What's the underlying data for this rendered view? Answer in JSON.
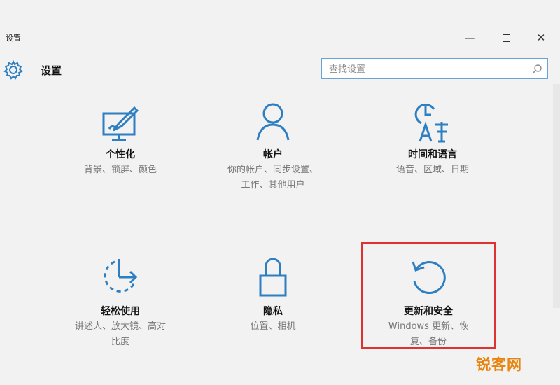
{
  "window": {
    "title": "设置",
    "controls": {
      "minimize": "—",
      "close": "✕"
    }
  },
  "header": {
    "title": "设置",
    "icon": "gear-icon",
    "accent_color": "#2e7fc1"
  },
  "search": {
    "placeholder": "查找设置",
    "icon": "search-icon"
  },
  "tiles": [
    {
      "label": "个性化",
      "desc_line1": "背景、锁屏、颜色",
      "desc_line2": "",
      "icon": "personalization-icon"
    },
    {
      "label": "帐户",
      "desc_line1": "你的帐户、同步设置、",
      "desc_line2": "工作、其他用户",
      "icon": "account-icon"
    },
    {
      "label": "时间和语言",
      "desc_line1": "语音、区域、日期",
      "desc_line2": "",
      "icon": "time-language-icon"
    },
    {
      "label": "轻松使用",
      "desc_line1": "讲述人、放大镜、高对",
      "desc_line2": "比度",
      "icon": "ease-of-access-icon"
    },
    {
      "label": "隐私",
      "desc_line1": "位置、相机",
      "desc_line2": "",
      "icon": "privacy-lock-icon"
    },
    {
      "label": "更新和安全",
      "desc_line1": "Windows 更新、恢",
      "desc_line2": "复、备份",
      "icon": "update-security-icon"
    }
  ],
  "highlight_color": "#dd3333",
  "watermark": "锐客网"
}
